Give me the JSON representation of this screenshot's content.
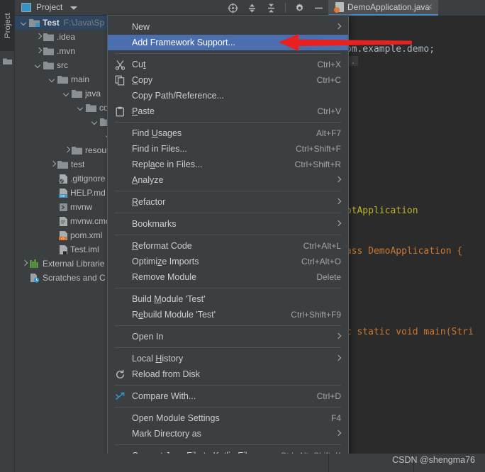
{
  "toolwindow": {
    "vertical_tab": "Project",
    "folder_icon": "folder-icon"
  },
  "panel": {
    "title": "Project",
    "dropdown_icon": "chevron-down-icon",
    "icons": [
      {
        "name": "locate-icon"
      },
      {
        "name": "expand-all-icon"
      },
      {
        "name": "collapse-all-icon"
      },
      {
        "name": "settings-gear-icon"
      },
      {
        "name": "hide-icon"
      }
    ]
  },
  "editor_tab": {
    "label": "DemoApplication.java",
    "close_icon": "close-icon",
    "file_icon": "java-class-icon"
  },
  "tree": {
    "items": [
      {
        "depth": 0,
        "twisty": "open",
        "icon": "folder-module",
        "label": "Test",
        "bold": true,
        "path": "F:\\Java\\Sp",
        "selected": true
      },
      {
        "depth": 1,
        "twisty": "closed",
        "icon": "folder",
        "label": ".idea"
      },
      {
        "depth": 1,
        "twisty": "closed",
        "icon": "folder",
        "label": ".mvn"
      },
      {
        "depth": 1,
        "twisty": "open",
        "icon": "folder",
        "label": "src"
      },
      {
        "depth": 2,
        "twisty": "open",
        "icon": "folder",
        "label": "main"
      },
      {
        "depth": 3,
        "twisty": "open",
        "icon": "folder",
        "label": "java"
      },
      {
        "depth": 4,
        "twisty": "open",
        "icon": "folder",
        "label": "com"
      },
      {
        "depth": 5,
        "twisty": "open",
        "icon": "folder",
        "label": ""
      },
      {
        "depth": 6,
        "twisty": "open",
        "icon": "folder",
        "label": ""
      },
      {
        "depth": 3,
        "twisty": "closed",
        "icon": "folder",
        "label": "resour"
      },
      {
        "depth": 2,
        "twisty": "closed",
        "icon": "folder",
        "label": "test"
      },
      {
        "depth": 2,
        "twisty": "none",
        "icon": "file-gitignore",
        "label": ".gitignore"
      },
      {
        "depth": 2,
        "twisty": "none",
        "icon": "file-md",
        "label": "HELP.md"
      },
      {
        "depth": 2,
        "twisty": "none",
        "icon": "file-shell",
        "label": "mvnw"
      },
      {
        "depth": 2,
        "twisty": "none",
        "icon": "file-cmd",
        "label": "mvnw.cmd"
      },
      {
        "depth": 2,
        "twisty": "none",
        "icon": "file-xml",
        "label": "pom.xml"
      },
      {
        "depth": 2,
        "twisty": "none",
        "icon": "file-iml",
        "label": "Test.iml"
      },
      {
        "depth": 0,
        "twisty": "closed",
        "icon": "library",
        "label": "External Librarie"
      },
      {
        "depth": 0,
        "twisty": "none",
        "icon": "scratches",
        "label": "Scratches and C"
      }
    ]
  },
  "context_menu": {
    "items": [
      {
        "type": "item",
        "label": "New",
        "mnemonic": "",
        "shortcut": "",
        "submenu": true,
        "highlight": false,
        "icon": ""
      },
      {
        "type": "item",
        "label": "Add Framework Support...",
        "mnemonic": "",
        "shortcut": "",
        "submenu": false,
        "highlight": true,
        "icon": ""
      },
      {
        "type": "sep"
      },
      {
        "type": "item",
        "label": "Cut",
        "mnemonic": "t",
        "shortcut": "Ctrl+X",
        "submenu": false,
        "highlight": false,
        "icon": "cut-icon"
      },
      {
        "type": "item",
        "label": "Copy",
        "mnemonic": "C",
        "shortcut": "Ctrl+C",
        "submenu": false,
        "highlight": false,
        "icon": "copy-icon"
      },
      {
        "type": "item",
        "label": "Copy Path/Reference...",
        "mnemonic": "",
        "shortcut": "",
        "submenu": false,
        "highlight": false,
        "icon": ""
      },
      {
        "type": "item",
        "label": "Paste",
        "mnemonic": "P",
        "shortcut": "Ctrl+V",
        "submenu": false,
        "highlight": false,
        "icon": "paste-icon"
      },
      {
        "type": "sep"
      },
      {
        "type": "item",
        "label": "Find Usages",
        "mnemonic": "U",
        "shortcut": "Alt+F7",
        "submenu": false,
        "highlight": false,
        "icon": ""
      },
      {
        "type": "item",
        "label": "Find in Files...",
        "mnemonic": "",
        "shortcut": "Ctrl+Shift+F",
        "submenu": false,
        "highlight": false,
        "icon": ""
      },
      {
        "type": "item",
        "label": "Replace in Files...",
        "mnemonic": "a",
        "shortcut": "Ctrl+Shift+R",
        "submenu": false,
        "highlight": false,
        "icon": ""
      },
      {
        "type": "item",
        "label": "Analyze",
        "mnemonic": "A",
        "shortcut": "",
        "submenu": true,
        "highlight": false,
        "icon": ""
      },
      {
        "type": "sep"
      },
      {
        "type": "item",
        "label": "Refactor",
        "mnemonic": "R",
        "shortcut": "",
        "submenu": true,
        "highlight": false,
        "icon": ""
      },
      {
        "type": "sep"
      },
      {
        "type": "item",
        "label": "Bookmarks",
        "mnemonic": "",
        "shortcut": "",
        "submenu": true,
        "highlight": false,
        "icon": ""
      },
      {
        "type": "sep"
      },
      {
        "type": "item",
        "label": "Reformat Code",
        "mnemonic": "R",
        "shortcut": "Ctrl+Alt+L",
        "submenu": false,
        "highlight": false,
        "icon": ""
      },
      {
        "type": "item",
        "label": "Optimize Imports",
        "mnemonic": "z",
        "shortcut": "Ctrl+Alt+O",
        "submenu": false,
        "highlight": false,
        "icon": ""
      },
      {
        "type": "item",
        "label": "Remove Module",
        "mnemonic": "",
        "shortcut": "Delete",
        "submenu": false,
        "highlight": false,
        "icon": ""
      },
      {
        "type": "sep"
      },
      {
        "type": "item",
        "label": "Build Module 'Test'",
        "mnemonic": "M",
        "shortcut": "",
        "submenu": false,
        "highlight": false,
        "icon": ""
      },
      {
        "type": "item",
        "label": "Rebuild Module 'Test'",
        "mnemonic": "e",
        "shortcut": "Ctrl+Shift+F9",
        "submenu": false,
        "highlight": false,
        "icon": ""
      },
      {
        "type": "sep"
      },
      {
        "type": "item",
        "label": "Open In",
        "mnemonic": "",
        "shortcut": "",
        "submenu": true,
        "highlight": false,
        "icon": ""
      },
      {
        "type": "sep"
      },
      {
        "type": "item",
        "label": "Local History",
        "mnemonic": "H",
        "shortcut": "",
        "submenu": true,
        "highlight": false,
        "icon": ""
      },
      {
        "type": "item",
        "label": "Reload from Disk",
        "mnemonic": "",
        "shortcut": "",
        "submenu": false,
        "highlight": false,
        "icon": "refresh-icon"
      },
      {
        "type": "sep"
      },
      {
        "type": "item",
        "label": "Compare With...",
        "mnemonic": "",
        "shortcut": "Ctrl+D",
        "submenu": false,
        "highlight": false,
        "icon": "compare-icon"
      },
      {
        "type": "sep"
      },
      {
        "type": "item",
        "label": "Open Module Settings",
        "mnemonic": "",
        "shortcut": "F4",
        "submenu": false,
        "highlight": false,
        "icon": ""
      },
      {
        "type": "item",
        "label": "Mark Directory as",
        "mnemonic": "",
        "shortcut": "",
        "submenu": true,
        "highlight": false,
        "icon": ""
      },
      {
        "type": "sep"
      },
      {
        "type": "item",
        "label": "Convert Java File to Kotlin File",
        "mnemonic": "",
        "shortcut": "Ctrl+Alt+Shift+K",
        "submenu": false,
        "highlight": false,
        "icon": ""
      }
    ]
  },
  "code": {
    "lines": [
      {
        "text": "com.example.demo;",
        "kind": "plain"
      },
      {
        "text": "",
        "kind": "plain"
      },
      {
        "text": "..",
        "kind": "fold"
      },
      {
        "text": "",
        "kind": "plain"
      },
      {
        "text": "ootApplication",
        "kind": "annotation"
      },
      {
        "text": "lass DemoApplication {",
        "kind": "mixed"
      },
      {
        "text": "",
        "kind": "plain"
      },
      {
        "text": "ic static void main(Stri",
        "kind": "mixed"
      }
    ]
  },
  "annotation": {
    "arrow_name": "red-pointer-arrow",
    "arrow_color": "#e8201f"
  },
  "watermark": {
    "text": "CSDN @shengma76"
  },
  "colors": {
    "panel_bg": "#3c3f41",
    "menu_bg": "#3c3f41",
    "menu_highlight": "#4b6eaf",
    "tree_selected": "#2f4661",
    "editor_bg": "#2b2b2b",
    "tab_accent": "#4a88c7"
  }
}
